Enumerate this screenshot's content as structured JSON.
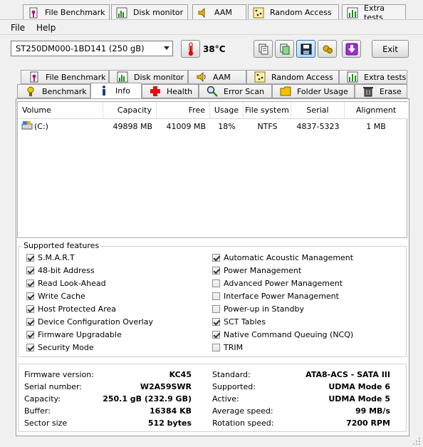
{
  "background_tabs": [
    {
      "label": "File Benchmark",
      "icon": "file-benchmark-icon"
    },
    {
      "label": "Disk monitor",
      "icon": "disk-monitor-icon"
    },
    {
      "label": "AAM",
      "icon": "speaker-icon"
    },
    {
      "label": "Random Access",
      "icon": "random-access-icon"
    },
    {
      "label": "Extra tests",
      "icon": "extra-tests-icon"
    }
  ],
  "menu": {
    "file": "File",
    "help": "Help"
  },
  "toolbar": {
    "drive": "ST250DM000-1BD141 (250 gB)",
    "temperature": "38°C",
    "buttons": [
      "copy-text-icon",
      "copy-screenshot-icon",
      "save-icon",
      "options-icon",
      "download-icon"
    ],
    "exit_label": "Exit"
  },
  "tabs_row1": [
    {
      "label": "File Benchmark",
      "icon": "file-benchmark-icon"
    },
    {
      "label": "Disk monitor",
      "icon": "disk-monitor-icon"
    },
    {
      "label": "AAM",
      "icon": "speaker-icon"
    },
    {
      "label": "Random Access",
      "icon": "random-access-icon"
    },
    {
      "label": "Extra tests",
      "icon": "extra-tests-icon"
    }
  ],
  "tabs_row2": [
    {
      "label": "Benchmark",
      "icon": "benchmark-icon"
    },
    {
      "label": "Info",
      "icon": "info-icon",
      "selected": true
    },
    {
      "label": "Health",
      "icon": "health-cross-icon"
    },
    {
      "label": "Error Scan",
      "icon": "magnifier-icon"
    },
    {
      "label": "Folder Usage",
      "icon": "folder-icon"
    },
    {
      "label": "Erase",
      "icon": "trash-icon"
    }
  ],
  "volumes": {
    "columns": [
      "Volume",
      "Capacity",
      "Free",
      "Usage",
      "File system",
      "Serial",
      "Alignment"
    ],
    "rows": [
      {
        "volume": "(C:)",
        "capacity": "49898 MB",
        "free": "41009 MB",
        "usage": "18%",
        "file_system": "NTFS",
        "serial": "4837-5323",
        "alignment": "1 MB"
      }
    ]
  },
  "features": {
    "title": "Supported features",
    "left": [
      {
        "label": "S.M.A.R.T",
        "checked": true
      },
      {
        "label": "48-bit Address",
        "checked": true
      },
      {
        "label": "Read Look-Ahead",
        "checked": true
      },
      {
        "label": "Write Cache",
        "checked": true
      },
      {
        "label": "Host Protected Area",
        "checked": true
      },
      {
        "label": "Device Configuration Overlay",
        "checked": true
      },
      {
        "label": "Firmware Upgradable",
        "checked": true
      },
      {
        "label": "Security Mode",
        "checked": true
      }
    ],
    "right": [
      {
        "label": "Automatic Acoustic Management",
        "checked": true
      },
      {
        "label": "Power Management",
        "checked": true
      },
      {
        "label": "Advanced Power Management",
        "checked": false
      },
      {
        "label": "Interface Power Management",
        "checked": false
      },
      {
        "label": "Power-up in Standby",
        "checked": false
      },
      {
        "label": "SCT Tables",
        "checked": true
      },
      {
        "label": "Native Command Queuing (NCQ)",
        "checked": true
      },
      {
        "label": "TRIM",
        "checked": false
      }
    ]
  },
  "details": {
    "left": [
      {
        "label": "Firmware version:",
        "value": "KC45"
      },
      {
        "label": "Serial number:",
        "value": "W2A59SWR"
      },
      {
        "label": "Capacity:",
        "value": "250.1 gB (232.9 GB)"
      },
      {
        "label": "Buffer:",
        "value": "16384 KB"
      },
      {
        "label": "Sector size",
        "value": "512 bytes"
      }
    ],
    "right": [
      {
        "label": "Standard:",
        "value": "ATA8-ACS - SATA III"
      },
      {
        "label": "Supported:",
        "value": "UDMA Mode 6"
      },
      {
        "label": "Active:",
        "value": "UDMA Mode 5"
      },
      {
        "label": "Average speed:",
        "value": "99 MB/s"
      },
      {
        "label": "Rotation speed:",
        "value": "7200 RPM"
      }
    ]
  }
}
